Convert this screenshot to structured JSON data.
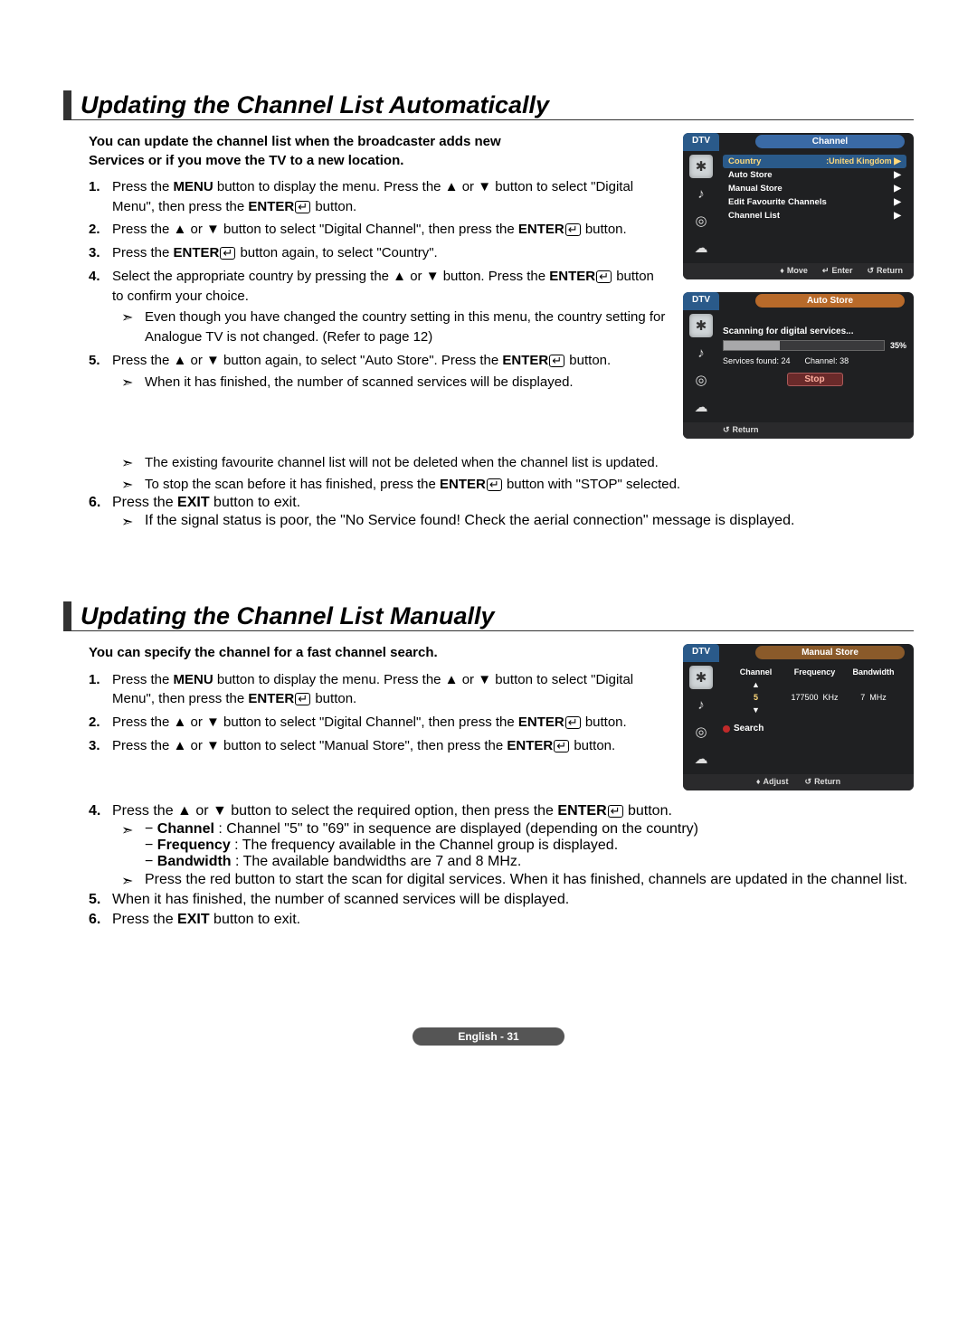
{
  "section1": {
    "title": "Updating the Channel List Automatically",
    "intro": "You can update the channel list when the broadcaster adds new Services or if you move the TV to a new location.",
    "s1_pre": "Press the ",
    "s1_menu": "MENU",
    "s1_mid": " button to display the menu. Press the ▲ or ▼ button to select \"Digital Menu\", then press the ",
    "s1_enter": "ENTER",
    "s1_post": " button.",
    "s2_pre": "Press the ▲ or ▼ button to select \"Digital Channel\", then press the ",
    "s2_enter": "ENTER",
    "s2_post": " button.",
    "s3_pre": "Press the ",
    "s3_enter": "ENTER",
    "s3_post": " button again, to select \"Country\".",
    "s4_pre": "Select the appropriate country by pressing the ▲ or ▼ button. Press the ",
    "s4_enter": "ENTER",
    "s4_post": " button to confirm your choice.",
    "s4_sub": "Even though you have changed the country setting in this menu, the country setting for Analogue TV is not changed. (Refer to page 12)",
    "s5_pre": "Press the ▲ or ▼ button again, to select \"Auto Store\". Press the ",
    "s5_enter": "ENTER",
    "s5_post": " button.",
    "s5_sub1": "When it has finished, the number of scanned services will be displayed.",
    "s5_sub2": "The existing favourite channel list will not be deleted when the channel list is updated.",
    "s5_sub3_pre": "To stop the scan before it has finished, press the ",
    "s5_sub3_enter": "ENTER",
    "s5_sub3_post": " button with \"STOP\" selected.",
    "s6_pre": "Press the ",
    "s6_exit": "EXIT",
    "s6_post": " button to exit.",
    "s6_sub": "If the signal status is poor, the \"No Service found! Check the aerial connection\" message is displayed."
  },
  "section2": {
    "title": "Updating the Channel List Manually",
    "intro": "You can specify the channel for a fast channel search.",
    "s1_pre": "Press the ",
    "s1_menu": "MENU",
    "s1_mid": " button to display the menu. Press the ▲ or ▼ button to select \"Digital Menu\", then press the ",
    "s1_enter": "ENTER",
    "s1_post": " button.",
    "s2_pre": "Press the ▲ or ▼ button to select \"Digital Channel\", then press the ",
    "s2_enter": "ENTER",
    "s2_post": " button.",
    "s3_pre": "Press the ▲ or ▼ button to select \"Manual Store\", then press the ",
    "s3_enter": "ENTER",
    "s3_post": " button.",
    "s4_pre": "Press the ▲ or ▼ button to select the required option, then press the ",
    "s4_enter": "ENTER",
    "s4_post": " button.",
    "s4_sub1_lead": "− ",
    "s4_ch_label": "Channel",
    "s4_ch_desc": " : Channel \"5\" to \"69\" in sequence are displayed (depending on the country)",
    "s4_fr_label": "Frequency",
    "s4_fr_desc": " : The frequency available in the Channel group is displayed.",
    "s4_bw_label": "Bandwidth",
    "s4_bw_desc": " : The available bandwidths are 7 and 8 MHz.",
    "s4_sub2": "Press the red button to start the scan for digital services. When it has finished, channels are updated in the channel list.",
    "s5": "When it has finished, the number of scanned services will be displayed.",
    "s6_pre": "Press the ",
    "s6_exit": "EXIT",
    "s6_post": " button to exit."
  },
  "osd1": {
    "dtv": "DTV",
    "title": "Channel",
    "rows": {
      "country_label": "Country",
      "country_value": ":United Kingdom",
      "auto_store": "Auto Store",
      "manual_store": "Manual Store",
      "edit_fav": "Edit Favourite Channels",
      "channel_list": "Channel List"
    },
    "footer": {
      "move": "Move",
      "enter": "Enter",
      "return": "Return"
    }
  },
  "osd2": {
    "dtv": "DTV",
    "title": "Auto Store",
    "scanning": "Scanning for digital services...",
    "percent": "35%",
    "services": "Services found: 24",
    "channel": "Channel: 38",
    "stop": "Stop",
    "return": "Return"
  },
  "osd3": {
    "dtv": "DTV",
    "title": "Manual Store",
    "headers": {
      "channel": "Channel",
      "frequency": "Frequency",
      "bandwidth": "Bandwidth"
    },
    "vals": {
      "channel": "5",
      "frequency": "177500",
      "khz": "KHz",
      "bw": "7",
      "mhz": "MHz"
    },
    "search": "Search",
    "adjust": "Adjust",
    "return": "Return"
  },
  "footer": "English - 31",
  "chart_data": {
    "type": "bar",
    "title": "Auto Store progress",
    "categories": [
      "Progress"
    ],
    "values": [
      35
    ],
    "ylim": [
      0,
      100
    ],
    "xlabel": "",
    "ylabel": "%"
  }
}
